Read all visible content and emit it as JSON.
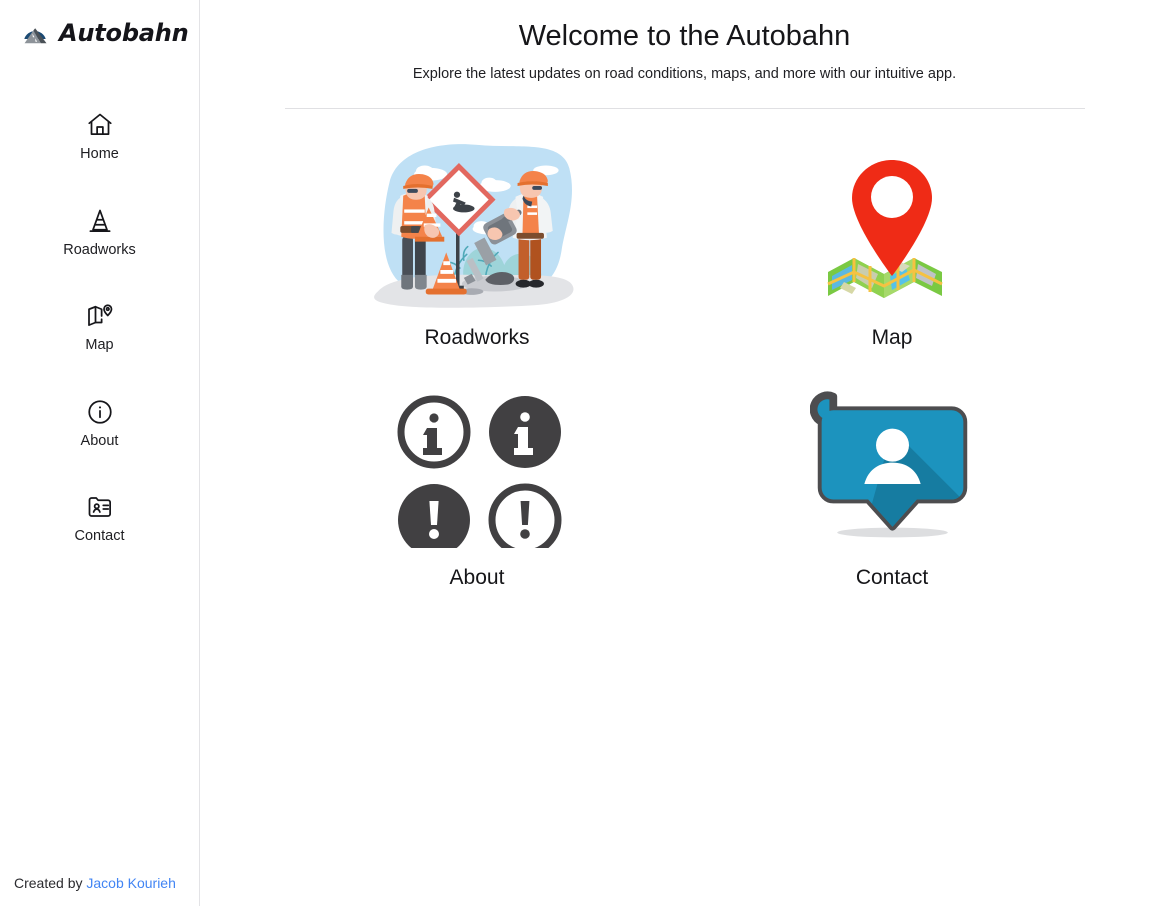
{
  "brand": {
    "name": "Autobahn",
    "logo_icon": "autobahn-road-logo",
    "logo_circle_color": "#1b4a73",
    "logo_road_color": "#6e7479"
  },
  "sidebar": {
    "items": [
      {
        "label": "Home",
        "icon": "home-icon"
      },
      {
        "label": "Roadworks",
        "icon": "traffic-cone-icon"
      },
      {
        "label": "Map",
        "icon": "map-pin-icon"
      },
      {
        "label": "About",
        "icon": "info-circle-icon"
      },
      {
        "label": "Contact",
        "icon": "contact-card-icon"
      }
    ],
    "footer": {
      "prefix": "Created by ",
      "author": "Jacob Kourieh",
      "link_color": "#4285f4"
    }
  },
  "header": {
    "title": "Welcome to the Autobahn",
    "subtitle": "Explore the latest updates on road conditions, maps, and more with our intuitive app."
  },
  "cards": [
    {
      "label": "Roadworks",
      "art": "roadworks-illustration"
    },
    {
      "label": "Map",
      "art": "map-pin-illustration"
    },
    {
      "label": "About",
      "art": "info-icons-illustration"
    },
    {
      "label": "Contact",
      "art": "contact-bubble-illustration"
    }
  ],
  "colors": {
    "accent_orange": "#f07c3e",
    "accent_red": "#ef2b16",
    "accent_blue": "#1c93be",
    "sky_blue": "#bfe0f5",
    "dark_gray": "#414042",
    "divider": "#e0e0e3",
    "text": "#161619"
  }
}
